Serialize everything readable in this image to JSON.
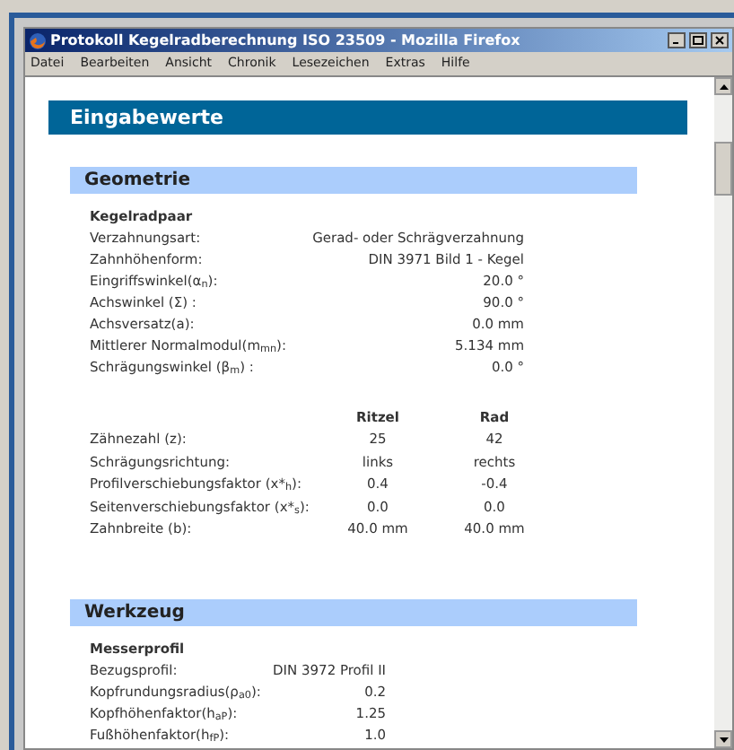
{
  "window": {
    "title": "Protokoll Kegelradberechnung ISO 23509 - Mozilla Firefox"
  },
  "menu": [
    "Datei",
    "Bearbeiten",
    "Ansicht",
    "Chronik",
    "Lesezeichen",
    "Extras",
    "Hilfe"
  ],
  "page_title": "Eingabewerte",
  "geometry": {
    "heading": "Geometrie",
    "subheading": "Kegelradpaar",
    "rows": [
      {
        "label": "Verzahnungsart:",
        "value": "Gerad- oder Schrägverzahnung"
      },
      {
        "label": "Zahnhöhenform:",
        "value": "DIN 3971 Bild 1 - Kegel"
      },
      {
        "label": "Eingriffswinkel(α$_{n}$):",
        "value": "20.0 °"
      },
      {
        "label": "Achswinkel (Σ) :",
        "value": "90.0 °"
      },
      {
        "label": "Achsversatz(a):",
        "value": "0.0 mm"
      },
      {
        "label": "Mittlerer Normalmodul(m$_{mn}$):",
        "value": "5.134 mm"
      },
      {
        "label": "Schrägungswinkel (β$_{m}$) :",
        "value": "0.0 °"
      }
    ],
    "table": {
      "columns": [
        "Ritzel",
        "Rad"
      ],
      "rows": [
        {
          "label": "Zähnezahl (z):",
          "cells": [
            "25",
            "42"
          ]
        },
        {
          "label": "Schrägungsrichtung:",
          "cells": [
            "links",
            "rechts"
          ]
        },
        {
          "label": "Profilverschiebungsfaktor (x*$_{h}$):",
          "cells": [
            "0.4",
            "-0.4"
          ]
        },
        {
          "label": "Seitenverschiebungsfaktor (x*$_{s}$):",
          "cells": [
            "0.0",
            "0.0"
          ]
        },
        {
          "label": "Zahnbreite (b):",
          "cells": [
            "40.0 mm",
            "40.0 mm"
          ]
        }
      ]
    }
  },
  "tool": {
    "heading": "Werkzeug",
    "subheading": "Messerprofil",
    "rows": [
      {
        "label": "Bezugsprofil:",
        "value": "DIN 3972 Profil II"
      },
      {
        "label": "Kopfrundungsradius(ρ$_{a0}$):",
        "value": "0.2"
      },
      {
        "label": "Kopfhöhenfaktor(h$_{aP}$):",
        "value": "1.25"
      },
      {
        "label": "Fußhöhenfaktor(h$_{fP}$):",
        "value": "1.0"
      }
    ]
  }
}
